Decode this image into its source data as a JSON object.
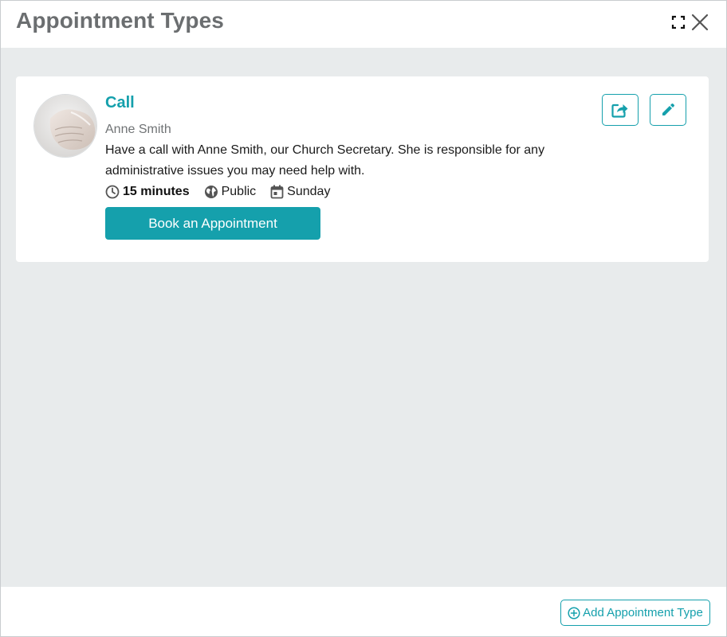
{
  "dialog": {
    "title": "Appointment Types",
    "icons": {
      "expand": "expand-icon",
      "close": "close-icon"
    }
  },
  "appointment": {
    "title": "Call",
    "host": "Anne Smith",
    "description": "Have a call with Anne Smith, our Church Secretary. She is responsible for any administrative issues you may need help with.",
    "duration": "15 minutes",
    "visibility": "Public",
    "day": "Sunday",
    "book_label": "Book an Appointment",
    "avatar_icon": "avatar-photo",
    "meta_icons": {
      "duration": "clock-icon",
      "visibility": "globe-icon",
      "day": "calendar-icon"
    },
    "action_icons": {
      "share": "share-icon",
      "edit": "pencil-icon"
    }
  },
  "footer": {
    "add_label": "Add Appointment Type",
    "add_icon": "plus-circle-icon"
  },
  "colors": {
    "accent": "#15a0ac",
    "title_gray": "#6b6e70",
    "background": "#e8ebec"
  }
}
